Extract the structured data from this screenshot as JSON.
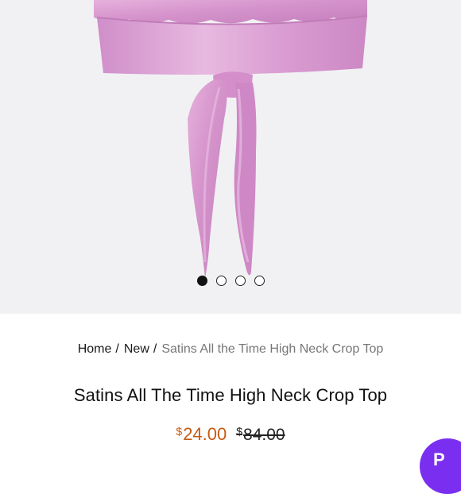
{
  "gallery": {
    "image_alt": "Pink satin high neck crop top with tie back",
    "dots": [
      {
        "active": true
      },
      {
        "active": false
      },
      {
        "active": false
      },
      {
        "active": false
      }
    ]
  },
  "breadcrumb": {
    "items": [
      "Home",
      "New"
    ],
    "current": "Satins All the Time High Neck Crop Top"
  },
  "product": {
    "title": "Satins All The Time High Neck Crop Top",
    "currency_symbol": "$",
    "sale_price": "24.00",
    "original_price": "84.00"
  },
  "colors": {
    "sale_price": "#c85a12",
    "fab": "#7a2ff0",
    "fabric": "#d99ad0"
  },
  "fab": {
    "label": "P",
    "icon": "chat-icon"
  }
}
